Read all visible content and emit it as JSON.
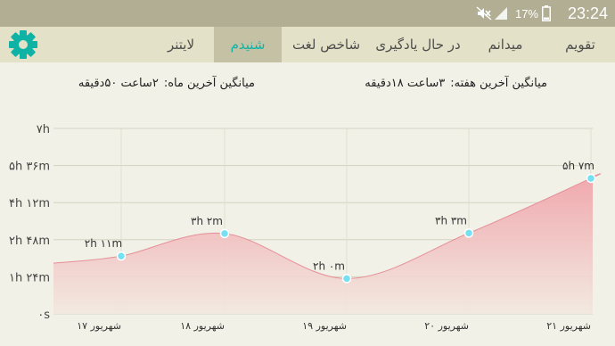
{
  "status_bar": {
    "time": "23:24",
    "battery_percent": "17%",
    "icons": [
      "mute-icon",
      "signal-icon",
      "battery-icon"
    ]
  },
  "tabs": [
    {
      "label": "تقویم",
      "active": false
    },
    {
      "label": "میدانم",
      "active": false
    },
    {
      "label": "در حال یادگیری",
      "active": false
    },
    {
      "label": "شاخص لغت",
      "active": false
    },
    {
      "label": "شنیدم",
      "active": true
    },
    {
      "label": "لایتنر",
      "active": false
    }
  ],
  "settings_icon": "gear-icon",
  "colors": {
    "accent": "#0fb3a6",
    "status_bar": "#b1ae93",
    "tab_bar": "#e3e1c7",
    "active_tab": "#c4c1a4",
    "area_fill": "#f0a3aa",
    "marker": "#74e0f2"
  },
  "averages": {
    "last_week_label": "میانگین آخرین هفته:",
    "last_week_value": "۳ساعت  ۱۸دقیقه",
    "last_month_label": "میانگین آخرین ماه:",
    "last_month_value": "۲ساعت  ۵۰دقیقه"
  },
  "chart_data": {
    "type": "area",
    "categories": [
      "۱۷ شهریور",
      "۱۸ شهریور",
      "۱۹ شهریور",
      "۲۰ شهریور",
      "۲۱ شهریور"
    ],
    "values_minutes": [
      131,
      182,
      80,
      183,
      307
    ],
    "data_labels": [
      "۲h ۱۱m",
      "۳h ۲m",
      "۲h ۰m",
      "۳h ۳m",
      "۵h ۷m"
    ],
    "y_ticks": [
      "۰s",
      "۱h ۲۴m",
      "۲h ۴۸m",
      "۴h ۱۲m",
      "۵h ۳۶m",
      "۷h"
    ],
    "ylim_minutes": [
      0,
      420
    ],
    "grid": true
  }
}
